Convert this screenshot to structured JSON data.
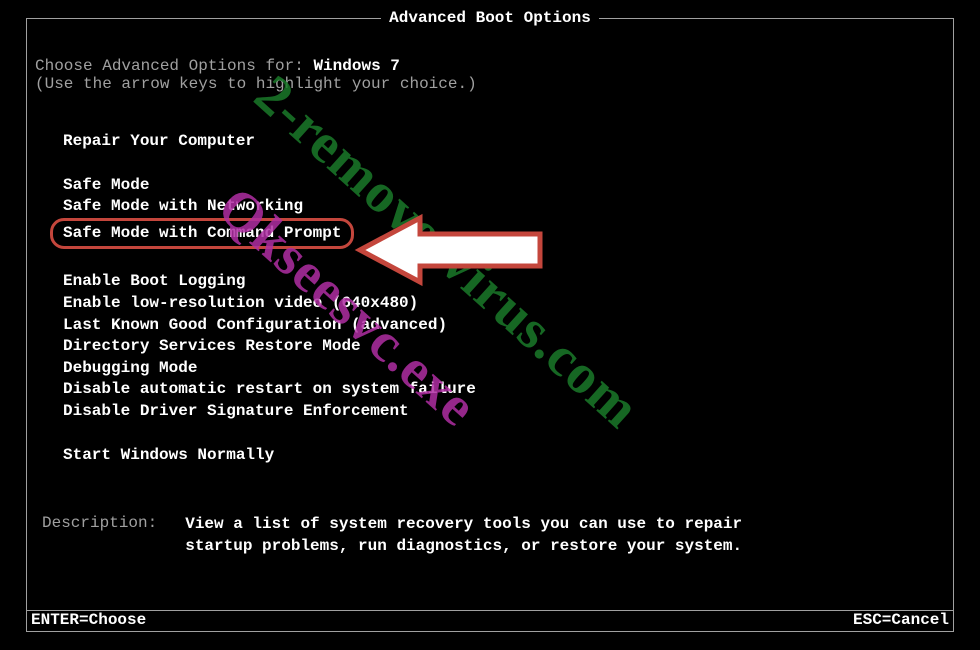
{
  "title": "Advanced Boot Options",
  "choose_label": "Choose Advanced Options for: ",
  "os_name": "Windows 7",
  "hint": "(Use the arrow keys to highlight your choice.)",
  "groups": [
    {
      "items": [
        "Repair Your Computer"
      ]
    },
    {
      "items": [
        "Safe Mode",
        "Safe Mode with Networking",
        "Safe Mode with Command Prompt"
      ],
      "highlighted_index": 2
    },
    {
      "items": [
        "Enable Boot Logging",
        "Enable low-resolution video (640x480)",
        "Last Known Good Configuration (advanced)",
        "Directory Services Restore Mode",
        "Debugging Mode",
        "Disable automatic restart on system failure",
        "Disable Driver Signature Enforcement"
      ]
    },
    {
      "items": [
        "Start Windows Normally"
      ]
    }
  ],
  "description": {
    "label": "Description:",
    "text_line1": "View a list of system recovery tools you can use to repair",
    "text_line2": "startup problems, run diagnostics, or restore your system."
  },
  "footer": {
    "left": "ENTER=Choose",
    "right": "ESC=Cancel"
  },
  "watermarks": {
    "line1": "2-remove-virus.com",
    "line2": "Qkseesvc.exe"
  },
  "colors": {
    "highlight_border": "#c4463c",
    "watermark_green": "#1b7a2a",
    "watermark_magenta": "#b02ea3"
  }
}
